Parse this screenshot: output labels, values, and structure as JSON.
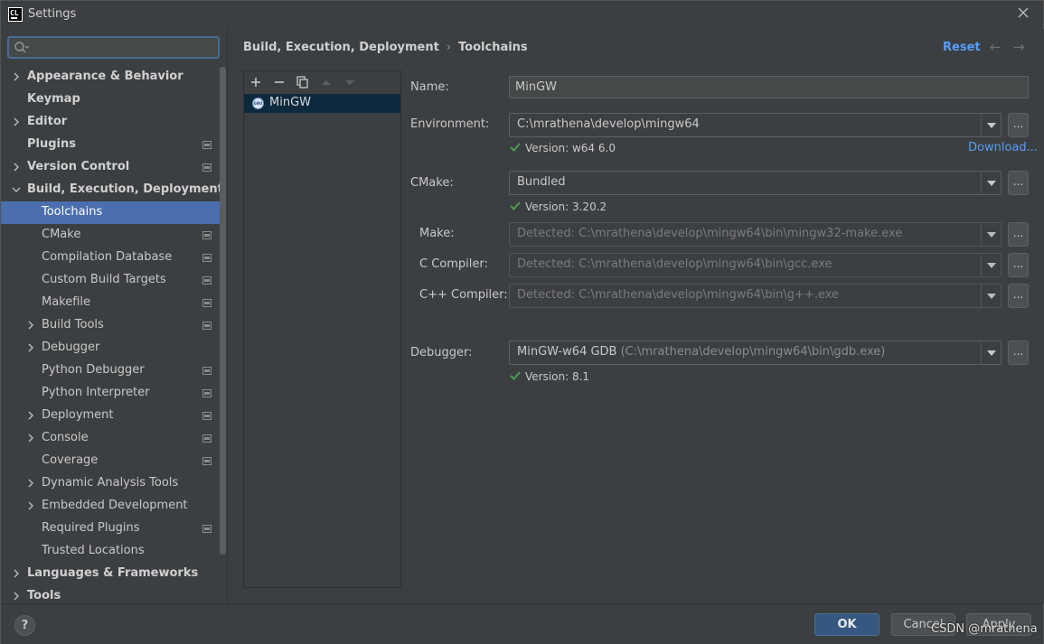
{
  "window": {
    "title": "Settings",
    "app_icon_text": "CL"
  },
  "search": {
    "placeholder": ""
  },
  "sidebar": {
    "items": [
      {
        "label": "Appearance & Behavior",
        "expandable": true,
        "bold": true
      },
      {
        "label": "Keymap",
        "expandable": false,
        "bold": true
      },
      {
        "label": "Editor",
        "expandable": true,
        "bold": true
      },
      {
        "label": "Plugins",
        "expandable": false,
        "bold": true,
        "page_icon": true
      },
      {
        "label": "Version Control",
        "expandable": true,
        "bold": true,
        "page_icon": true
      },
      {
        "label": "Build, Execution, Deployment",
        "expandable": true,
        "expanded": true,
        "bold": true
      },
      {
        "label": "Toolchains",
        "selected": true
      },
      {
        "label": "CMake",
        "page_icon": true
      },
      {
        "label": "Compilation Database",
        "page_icon": true
      },
      {
        "label": "Custom Build Targets",
        "page_icon": true
      },
      {
        "label": "Makefile",
        "page_icon": true
      },
      {
        "label": "Build Tools",
        "expandable": true,
        "page_icon": true
      },
      {
        "label": "Debugger",
        "expandable": true
      },
      {
        "label": "Python Debugger",
        "page_icon": true
      },
      {
        "label": "Python Interpreter",
        "page_icon": true
      },
      {
        "label": "Deployment",
        "expandable": true,
        "page_icon": true
      },
      {
        "label": "Console",
        "expandable": true,
        "page_icon": true
      },
      {
        "label": "Coverage",
        "page_icon": true
      },
      {
        "label": "Dynamic Analysis Tools",
        "expandable": true
      },
      {
        "label": "Embedded Development",
        "expandable": true
      },
      {
        "label": "Required Plugins",
        "page_icon": true
      },
      {
        "label": "Trusted Locations"
      },
      {
        "label": "Languages & Frameworks",
        "expandable": true,
        "bold": true
      },
      {
        "label": "Tools",
        "expandable": true,
        "bold": true
      }
    ]
  },
  "header": {
    "breadcrumb_parent": "Build, Execution, Deployment",
    "breadcrumb_sep": "›",
    "breadcrumb_current": "Toolchains",
    "reset_label": "Reset",
    "back_icon": "←",
    "forward_icon": "→"
  },
  "toolchains": {
    "toolbar": {
      "add": "+",
      "remove": "−",
      "copy": "copy-icon",
      "up": "up-icon",
      "down": "down-icon"
    },
    "items": [
      {
        "label": "MinGW"
      }
    ]
  },
  "form": {
    "name_label": "Name:",
    "name_value": "MinGW",
    "environment_label": "Environment:",
    "environment_value": "C:\\mrathena\\develop\\mingw64",
    "environment_version": "Version: w64 6.0",
    "download_link": "Download...",
    "cmake_label": "CMake:",
    "cmake_value": "Bundled",
    "cmake_version": "Version: 3.20.2",
    "make_label": "Make:",
    "make_value": "Detected: C:\\mrathena\\develop\\mingw64\\bin\\mingw32-make.exe",
    "c_compiler_label": "C Compiler:",
    "c_compiler_value": "Detected: C:\\mrathena\\develop\\mingw64\\bin\\gcc.exe",
    "cpp_compiler_label": "C++ Compiler:",
    "cpp_compiler_value": "Detected: C:\\mrathena\\develop\\mingw64\\bin\\g++.exe",
    "debugger_label": "Debugger:",
    "debugger_value": "MinGW-w64 GDB",
    "debugger_path": "(C:\\mrathena\\develop\\mingw64\\bin\\gdb.exe)",
    "debugger_version": "Version: 8.1",
    "browse_label": "..."
  },
  "footer": {
    "help_label": "?",
    "ok_label": "OK",
    "cancel_label": "Cancel",
    "apply_label": "Apply"
  },
  "watermark": "CSDN @mrathena",
  "colors": {
    "accent": "#4b6eaf",
    "link": "#589df6",
    "check": "#499c54",
    "primary_button": "#365880"
  }
}
